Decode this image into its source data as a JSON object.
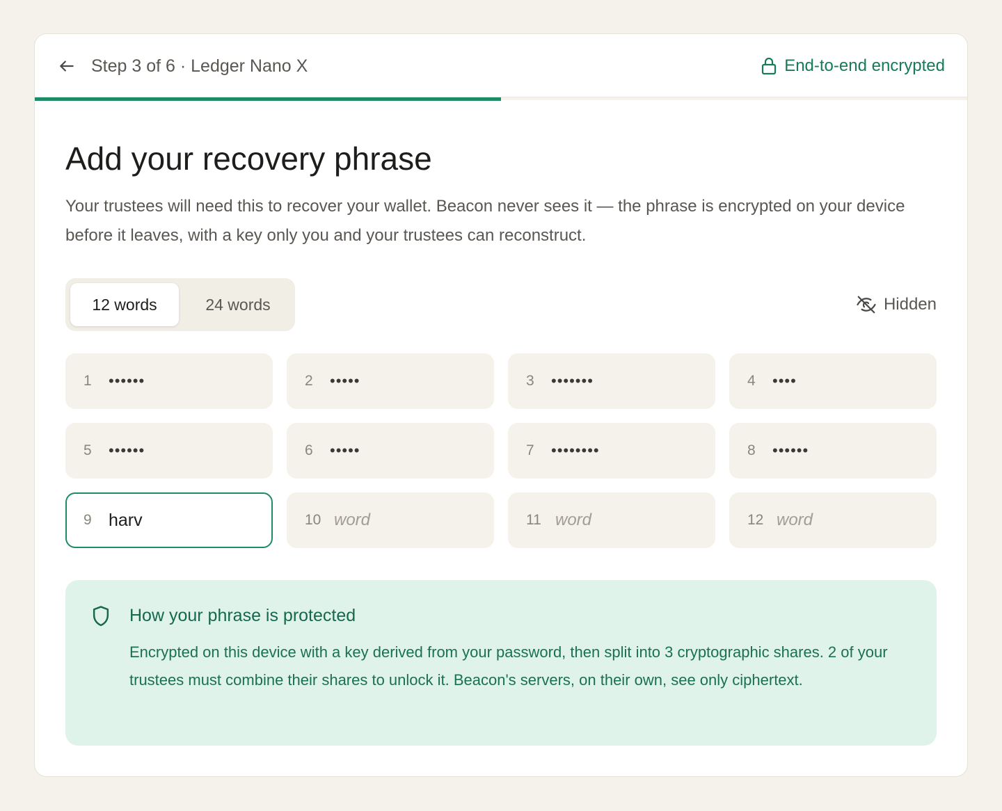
{
  "header": {
    "step_text": "Step 3 of 6 · Ledger Nano X",
    "encryption_label": "End-to-end encrypted",
    "progress_fraction": 0.5
  },
  "main": {
    "title": "Add your recovery phrase",
    "description": "Your trustees will need this to recover your wallet. Beacon never sees it — the phrase is encrypted on your device before it leaves, with a key only you and your trustees can reconstruct."
  },
  "word_count_toggle": {
    "options": [
      "12 words",
      "24 words"
    ],
    "selected": "12 words"
  },
  "visibility_toggle": {
    "label": "Hidden",
    "icon": "eye-off-icon"
  },
  "words": [
    {
      "num": "1",
      "value": "••••••",
      "state": "masked"
    },
    {
      "num": "2",
      "value": "•••••",
      "state": "masked"
    },
    {
      "num": "3",
      "value": "•••••••",
      "state": "masked"
    },
    {
      "num": "4",
      "value": "••••",
      "state": "masked"
    },
    {
      "num": "5",
      "value": "••••••",
      "state": "masked"
    },
    {
      "num": "6",
      "value": "•••••",
      "state": "masked"
    },
    {
      "num": "7",
      "value": "••••••••",
      "state": "masked"
    },
    {
      "num": "8",
      "value": "••••••",
      "state": "masked"
    },
    {
      "num": "9",
      "value": "harv",
      "state": "active"
    },
    {
      "num": "10",
      "placeholder": "word",
      "state": "empty"
    },
    {
      "num": "11",
      "placeholder": "word",
      "state": "empty"
    },
    {
      "num": "12",
      "placeholder": "word",
      "state": "empty"
    }
  ],
  "info": {
    "title": "How your phrase is protected",
    "text": "Encrypted on this device with a key derived from your password, then split into 3 cryptographic shares. 2 of your trustees must combine their shares to unlock it. Beacon's servers, on their own, see only ciphertext.",
    "icon": "shield-icon"
  },
  "colors": {
    "accent": "#1f8a68",
    "background": "#f4f2ea",
    "info_bg": "#e0f3eb"
  }
}
